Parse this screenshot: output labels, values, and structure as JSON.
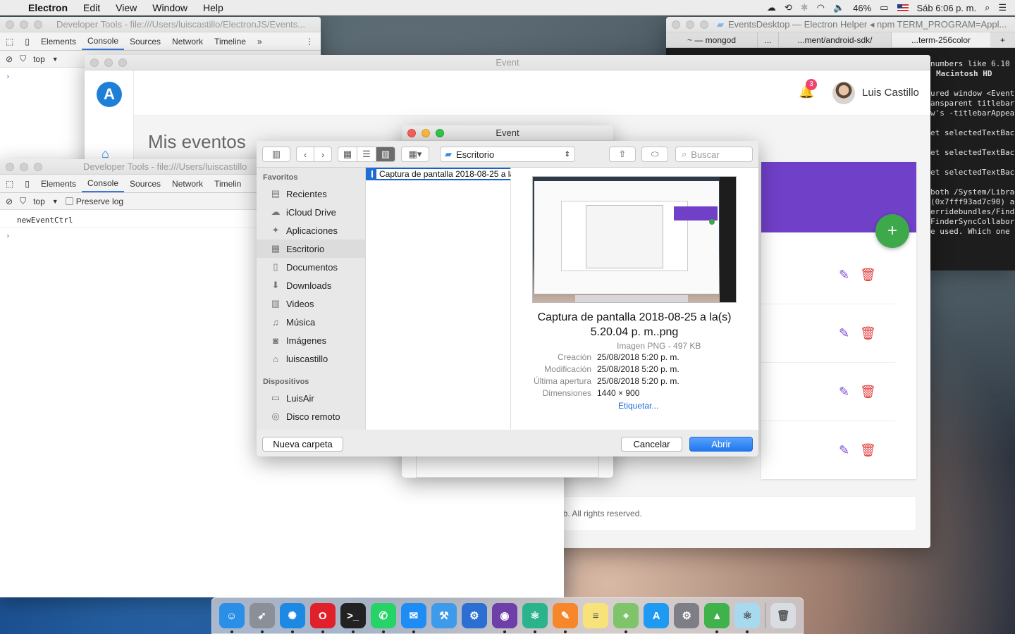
{
  "menubar": {
    "app_name": "Electron",
    "items": [
      "Edit",
      "View",
      "Window",
      "Help"
    ],
    "battery": "46%",
    "clock": "Sáb 6:06 p. m."
  },
  "devtools_top": {
    "title": "Developer Tools - file:///Users/luiscastillo/ElectronJS/Events...",
    "tabs": [
      "Elements",
      "Console",
      "Sources",
      "Network",
      "Timeline"
    ],
    "more": "»",
    "context": "top",
    "prompt": "›"
  },
  "terminal": {
    "title": "EventsDesktop — Electron Helper ◂ npm TERM_PROGRAM=Appl...",
    "tabs": [
      "~ — mongod",
      "...",
      "...ment/android-sdk/",
      "...term-256color"
    ],
    "lines": [
      "numbers like 6.10",
      "Macintosh HD",
      "",
      "ured window <Event",
      "ansparent titlebar",
      "w's -titlebarAppea",
      "",
      "et selectedTextBac",
      "",
      "et selectedTextBac",
      "",
      "et selectedTextBac",
      "",
      "both /System/Libra",
      "(0x7fff93ad7c90) a",
      "erridebundles/Find",
      "FinderSyncCollabor",
      "e used. Which one"
    ]
  },
  "event_app": {
    "title": "Event",
    "logo": "A",
    "notif_count": "3",
    "user_name": "Luis Castillo",
    "page_title": "Mis eventos",
    "add_label": "+",
    "footer": "ib. All rights reserved."
  },
  "devtools_bottom": {
    "title": "Developer Tools - file:///Users/luiscastillo",
    "tabs": [
      "Elements",
      "Console",
      "Sources",
      "Network",
      "Timelin"
    ],
    "context": "top",
    "preserve_log": "Preserve log",
    "log_line": "newEventCtrl",
    "prompt": "›"
  },
  "event_modal": {
    "title": "Event"
  },
  "file_dialog": {
    "location": "Escritorio",
    "search_placeholder": "Buscar",
    "favorites_header": "Favoritos",
    "favorites": [
      {
        "label": "Recientes",
        "icon": "clock-icon",
        "glyph": "▤"
      },
      {
        "label": "iCloud Drive",
        "icon": "cloud-icon",
        "glyph": "☁"
      },
      {
        "label": "Aplicaciones",
        "icon": "applications-icon",
        "glyph": "✦"
      },
      {
        "label": "Escritorio",
        "icon": "desktop-icon",
        "glyph": "▦"
      },
      {
        "label": "Documentos",
        "icon": "document-icon",
        "glyph": "▯"
      },
      {
        "label": "Downloads",
        "icon": "download-icon",
        "glyph": "⬇"
      },
      {
        "label": "Videos",
        "icon": "film-icon",
        "glyph": "▥"
      },
      {
        "label": "Música",
        "icon": "music-icon",
        "glyph": "♫"
      },
      {
        "label": "Imágenes",
        "icon": "camera-icon",
        "glyph": "◙"
      },
      {
        "label": "luiscastillo",
        "icon": "home-icon",
        "glyph": "⌂"
      }
    ],
    "devices_header": "Dispositivos",
    "devices": [
      {
        "label": "LuisAir",
        "icon": "laptop-icon",
        "glyph": "▭"
      },
      {
        "label": "Disco remoto",
        "icon": "disc-icon",
        "glyph": "◎"
      }
    ],
    "selected_file": "Captura de pantalla 2018-08-25 a la(s) 5.20.04 p. m..png",
    "preview_name": "Captura de pantalla 2018-08-25 a la(s) 5.20.04 p. m..png",
    "kind": "Imagen PNG - 497 KB",
    "meta": [
      {
        "k": "Creación",
        "v": "25/08/2018 5:20 p. m."
      },
      {
        "k": "Modificación",
        "v": "25/08/2018 5:20 p. m."
      },
      {
        "k": "Última apertura",
        "v": "25/08/2018 5:20 p. m."
      },
      {
        "k": "Dimensiones",
        "v": "1440 × 900"
      }
    ],
    "tag_link": "Etiquetar...",
    "new_folder": "Nueva carpeta",
    "cancel": "Cancelar",
    "open": "Abrir"
  },
  "dock": [
    {
      "name": "finder",
      "bg": "#2b8fe8",
      "g": "☺"
    },
    {
      "name": "launchpad",
      "bg": "#8a8f98",
      "g": "➶"
    },
    {
      "name": "safari",
      "bg": "#1e88e5",
      "g": "✺"
    },
    {
      "name": "opera",
      "bg": "#e0202a",
      "g": "O"
    },
    {
      "name": "terminal",
      "bg": "#222222",
      "g": ">_"
    },
    {
      "name": "whatsapp",
      "bg": "#25d366",
      "g": "✆"
    },
    {
      "name": "messenger",
      "bg": "#1e8cf5",
      "g": "✉"
    },
    {
      "name": "xcode",
      "bg": "#3d9be9",
      "g": "⚒"
    },
    {
      "name": "instruments",
      "bg": "#2a6fd1",
      "g": "⚙"
    },
    {
      "name": "github",
      "bg": "#6e3fa8",
      "g": "◉"
    },
    {
      "name": "atom",
      "bg": "#2bb38b",
      "g": "⚛"
    },
    {
      "name": "sketch",
      "bg": "#f6872a",
      "g": "✎"
    },
    {
      "name": "notes",
      "bg": "#f8e27a",
      "g": "≡"
    },
    {
      "name": "maps",
      "bg": "#7fc46b",
      "g": "⌖"
    },
    {
      "name": "app-store",
      "bg": "#1f9af2",
      "g": "A"
    },
    {
      "name": "system-preferences",
      "bg": "#7e7e86",
      "g": "⚙"
    },
    {
      "name": "robomongo",
      "bg": "#3fb24b",
      "g": "▲"
    },
    {
      "name": "electron",
      "bg": "#a7d9ef",
      "g": "⚛"
    },
    {
      "name": "trash",
      "bg": "#d9dce1",
      "g": "🗑"
    }
  ]
}
